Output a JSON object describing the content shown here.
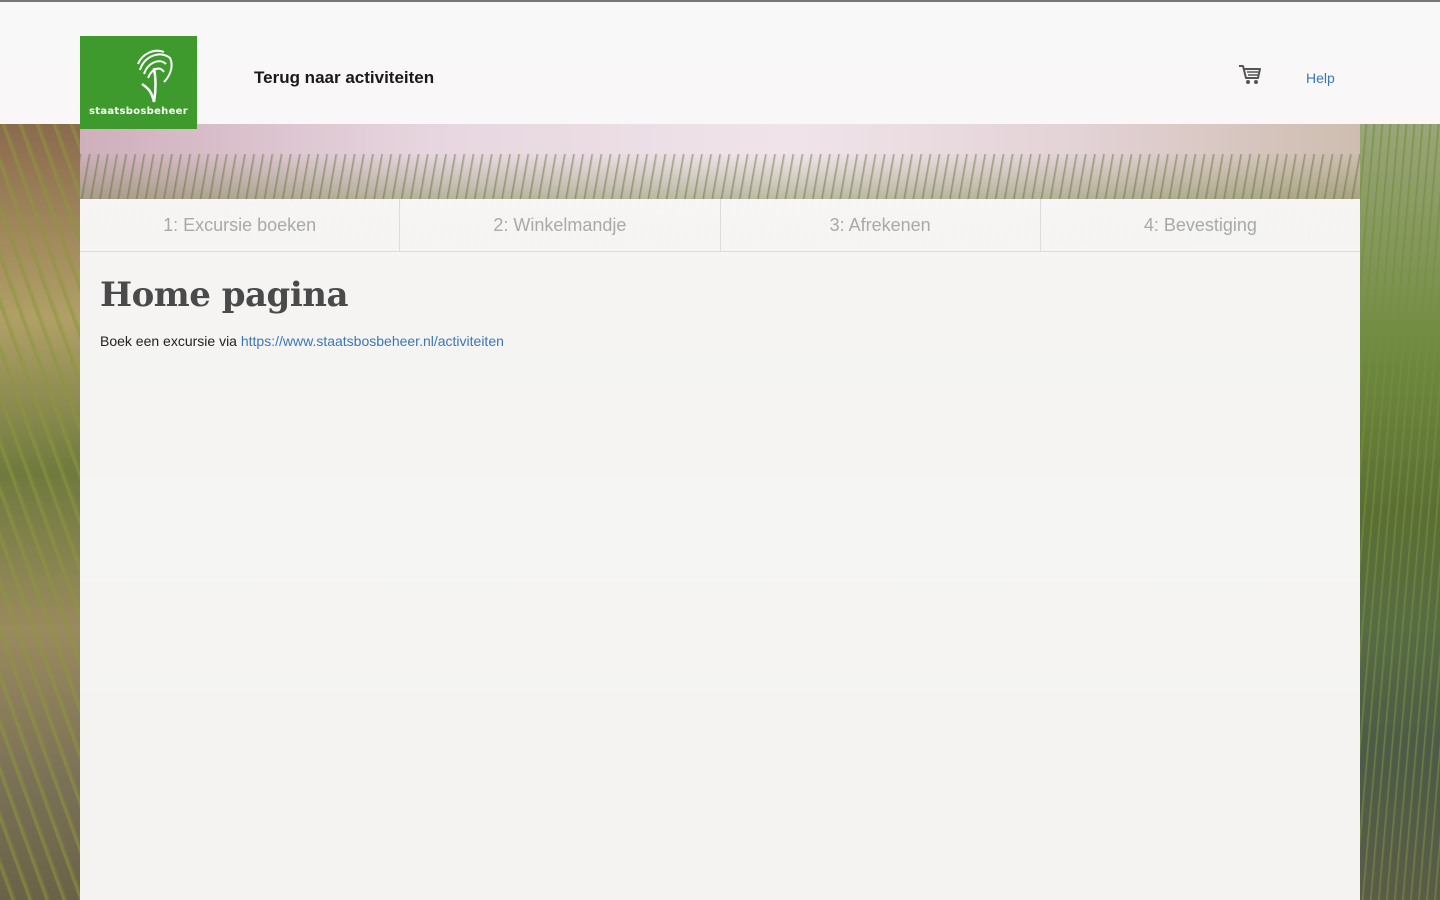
{
  "header": {
    "logo_text": "staatsbosbeheer",
    "back_label": "Terug naar activiteiten",
    "cart_icon": "shopping-cart-icon",
    "help_label": "Help"
  },
  "steps": [
    {
      "label": "1: Excursie boeken"
    },
    {
      "label": "2: Winkelmandje"
    },
    {
      "label": "3: Afrekenen"
    },
    {
      "label": "4: Bevestiging"
    }
  ],
  "main": {
    "title": "Home pagina",
    "intro_text": "Boek een excursie via ",
    "intro_link": "https://www.staatsbosbeheer.nl/activiteiten"
  },
  "colors": {
    "brand_green": "#3f9a2e",
    "link_blue": "#3a78b5"
  }
}
